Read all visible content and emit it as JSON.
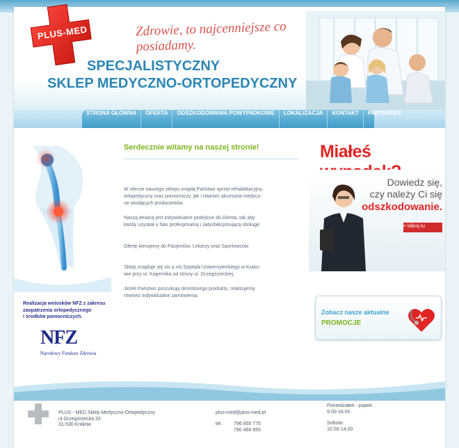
{
  "header": {
    "logo_text": "PLUS-MED",
    "slogan": "Zdrowie, to najcenniejsze co posiadamy.",
    "title_line1": "SPECJALISTYCZNY",
    "title_line2": "SKLEP MEDYCZNO-ORTOPEDYCZNY"
  },
  "nav": {
    "items": [
      {
        "label": "STRONA GŁÓWNA"
      },
      {
        "label": "OFERTA"
      },
      {
        "label": "ODSZKODOWANIA POWYPADKOWE"
      },
      {
        "label": "LOKALIZACJA"
      },
      {
        "label": "KONTAKT"
      },
      {
        "label": "PARTNERZY"
      }
    ]
  },
  "left": {
    "nfz_info_line1": "Realizacja wniosków NFZ z zakresu",
    "nfz_info_line2": "zaopatrzenia ortopedycznego",
    "nfz_info_line3": "i środków pomocniczych.",
    "nfz_logo": "NFZ",
    "nfz_name": "Narodowy Fundusz Zdrowia"
  },
  "main": {
    "welcome": "Serdecznie witamy na naszej stronie!",
    "p1_l1": "W ofercie naszego sklepu znajdą Państwo sprzęt rehabilitacyjny,",
    "p1_l2": "ortopedyczny oraz pomocniczy, jak i również akcesoria medycz-",
    "p1_l3": "ne wiodących producentów.",
    "p2_l1": "Naszą dewizą jest indywidualne podejście do klienta, tak aby",
    "p2_l2": "każdy uzyskał u Nas profesjonalną i satysfakcjonującą obsługę.",
    "p3_l1": "Ofertę kierujemy do Pacjentów, Lekarzy oraz Sportowców.",
    "p4_l1": "Sklep znajduje się vis a vis Szpitala Uniwersyteckiego w Krako-",
    "p4_l2": "wie przy ul. Kopernika od strony ul. Grzegórzeckiej.",
    "p5_l1": "Jeżeli Państwo poszukują określonego produktu, realizujemy",
    "p5_l2": "również indywidualne zamówienia."
  },
  "right": {
    "accident_title": "Miałeś wypadek?",
    "ad_line1": "Dowiedz się,",
    "ad_line2": "czy należy Ci się",
    "ad_line3": "odszkodowanie.",
    "ad_click": "> kliknij tu",
    "promo_line1": "Zobacz nasze aktualne",
    "promo_line2": "PROMOCJE"
  },
  "footer": {
    "company": "PLUS - MED Sklep Medyczno-Ortopedyczny",
    "street": "ul.Grzegórzecka 33",
    "city": "31-530 Kraków",
    "email": "plus-med@plus-med.pl",
    "tel_label": "tel.",
    "tel1": "796 855 775",
    "tel2": "790 466 655",
    "hours_weekday_label": "Poniedziałek - piątek:",
    "hours_weekday": "9.00-18.00",
    "hours_saturday_label": "Sobota:",
    "hours_saturday": "10.00-14.00"
  },
  "colors": {
    "brand_blue": "#2c86b3",
    "accent_red": "#e02525",
    "accent_green": "#7cb31f"
  }
}
